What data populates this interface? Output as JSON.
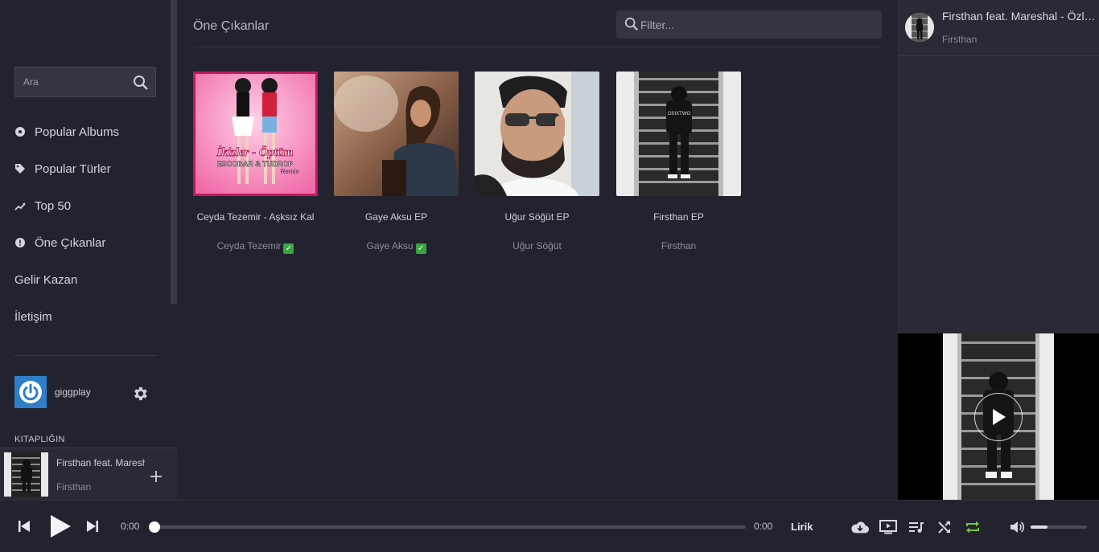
{
  "sidebar": {
    "search_placeholder": "Ara",
    "nav": [
      {
        "label": "Popular Albums",
        "icon": "disc-icon"
      },
      {
        "label": "Popular Türler",
        "icon": "tag-icon"
      },
      {
        "label": "Top 50",
        "icon": "trending-icon"
      },
      {
        "label": "Öne Çıkanlar",
        "icon": "badge-icon"
      },
      {
        "label": "Gelir Kazan"
      },
      {
        "label": "İletişim"
      }
    ],
    "user": {
      "name": "giggplay"
    },
    "library_label": "KITAPLIĞIN",
    "now_playing": {
      "title": "Firsthan feat. Mareshal - Özledim",
      "artist": "Firsthan"
    }
  },
  "main": {
    "title": "Öne Çıkanlar",
    "filter_placeholder": "Filter...",
    "albums": [
      {
        "name": "Ceyda Tezemir - Aşksız Kal",
        "artist": "Ceyda Tezemir",
        "verified": true
      },
      {
        "name": "Gaye Aksu EP",
        "artist": "Gaye Aksu",
        "verified": true
      },
      {
        "name": "Uğur Söğüt EP",
        "artist": "Uğur Söğüt",
        "verified": false
      },
      {
        "name": "Firsthan EP",
        "artist": "Firsthan",
        "verified": false
      }
    ],
    "cover_text": {
      "line1": "İkizler - Öptüm",
      "line2": "ESCOBAR & TUDROP",
      "line3": "Remix",
      "shirt": "OSIXTWO"
    }
  },
  "queue": {
    "items": [
      {
        "title": "Firsthan feat. Mareshal - Özledim",
        "artist": "Firsthan"
      }
    ]
  },
  "player": {
    "current_time": "0:00",
    "total_time": "0:00",
    "progress": 0,
    "lyrics_label": "Lirik",
    "volume": 0.3
  },
  "colors": {
    "accent_repeat": "#7bc142",
    "avatar_blue": "#2f7fc8",
    "verified_green": "#3aa641"
  }
}
